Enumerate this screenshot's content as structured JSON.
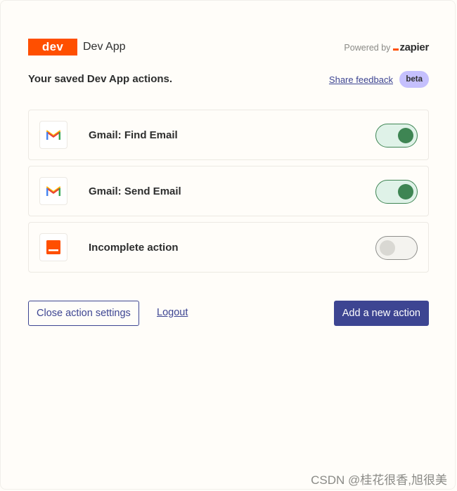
{
  "header": {
    "logo_text": "dev",
    "app_name": "Dev App",
    "powered_by": "Powered by",
    "zapier_brand": "zapier"
  },
  "subheader": {
    "title": "Your saved Dev App actions.",
    "feedback_link": "Share feedback",
    "beta_badge": "beta"
  },
  "actions": [
    {
      "label": "Gmail: Find Email",
      "icon": "gmail-icon",
      "enabled": true
    },
    {
      "label": "Gmail: Send Email",
      "icon": "gmail-icon",
      "enabled": true
    },
    {
      "label": "Incomplete action",
      "icon": "dev-app-icon",
      "enabled": false
    }
  ],
  "footer": {
    "close_label": "Close action settings",
    "logout_label": "Logout",
    "add_label": "Add a new action"
  },
  "watermark": "CSDN @桂花很香,旭很美",
  "colors": {
    "brand_orange": "#FF4F00",
    "primary": "#3D4592",
    "toggle_on": "#3E8553",
    "beta_bg": "#C5C0FD",
    "background": "#FFFDF9"
  }
}
